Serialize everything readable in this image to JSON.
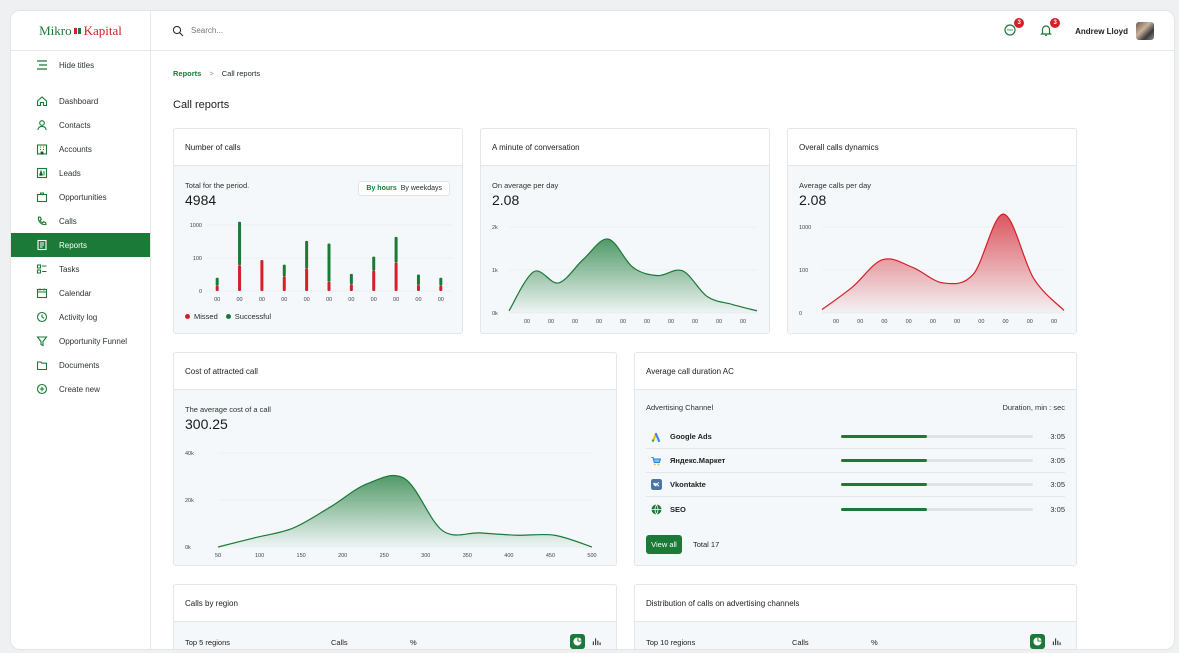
{
  "brand": {
    "left": "Mikro",
    "right": "Kapital"
  },
  "sidebar": {
    "hide_titles": "Hide titles",
    "items": [
      {
        "label": "Dashboard",
        "icon": "home-icon"
      },
      {
        "label": "Contacts",
        "icon": "person-icon"
      },
      {
        "label": "Accounts",
        "icon": "building-icon"
      },
      {
        "label": "Leads",
        "icon": "leads-icon"
      },
      {
        "label": "Opportunities",
        "icon": "briefcase-icon"
      },
      {
        "label": "Calls",
        "icon": "phone-icon"
      },
      {
        "label": "Reports",
        "icon": "report-icon",
        "active": true
      },
      {
        "label": "Tasks",
        "icon": "tasks-icon"
      },
      {
        "label": "Calendar",
        "icon": "calendar-icon"
      },
      {
        "label": "Activity log",
        "icon": "activity-icon"
      },
      {
        "label": "Opportunity Funnel",
        "icon": "funnel-icon"
      },
      {
        "label": "Documents",
        "icon": "folder-icon"
      },
      {
        "label": "Create new",
        "icon": "plus-circle-icon"
      }
    ]
  },
  "header": {
    "search_placeholder": "Search...",
    "chat_badge": "3",
    "bell_badge": "3",
    "user_name": "Andrew Lloyd"
  },
  "breadcrumb": {
    "parent": "Reports",
    "separator": ">",
    "current": "Call reports"
  },
  "page_title": "Call reports",
  "colors": {
    "accent": "#1b7a37",
    "missed": "#d3202b"
  },
  "cards": {
    "number_of_calls": {
      "title": "Number of calls",
      "subtitle": "Total for the period.",
      "value": "4984",
      "toggle": [
        "By hours",
        "By weekdays"
      ],
      "legend": [
        "Missed",
        "Successful"
      ]
    },
    "minute_conversation": {
      "title": "A minute of conversation",
      "subtitle": "On average per day",
      "value": "2.08"
    },
    "overall_dynamics": {
      "title": "Overall calls dynamics",
      "subtitle": "Average calls per day",
      "value": "2.08"
    },
    "cost_attracted": {
      "title": "Cost of attracted call",
      "subtitle": "The average cost of a call",
      "value": "300.25"
    },
    "avg_duration": {
      "title": "Average call duration AC",
      "col_channel": "Advertising Channel",
      "col_duration": "Duration, min : sec",
      "rows": [
        {
          "name": "Google Ads",
          "duration": "3:05",
          "share": 0.45,
          "icon": "google-ads-icon"
        },
        {
          "name": "Яндекс.Маркет",
          "duration": "3:05",
          "share": 0.45,
          "icon": "cart-icon"
        },
        {
          "name": "Vkontakte",
          "duration": "3:05",
          "share": 0.45,
          "icon": "vk-icon"
        },
        {
          "name": "SEO",
          "duration": "3:05",
          "share": 0.45,
          "icon": "globe-icon"
        }
      ],
      "view_all": "View all",
      "total": "Total 17"
    },
    "calls_by_region": {
      "title": "Calls by region",
      "cols": [
        "Top 5 regions",
        "Calls",
        "%"
      ]
    },
    "distribution": {
      "title": "Distribution of calls on advertising channels",
      "cols": [
        "Top 10 regions",
        "Calls",
        "%"
      ]
    }
  },
  "chart_data": [
    {
      "type": "bar",
      "title": "Number of calls",
      "y_ticks": [
        "1000",
        "100",
        "0"
      ],
      "categories": [
        "00",
        "00",
        "00",
        "00",
        "00",
        "00",
        "00",
        "00",
        "00",
        "00",
        "00"
      ],
      "ylim": [
        0,
        1000
      ],
      "series": [
        {
          "name": "Missed",
          "color": "#d3202b",
          "values": [
            80,
            390,
            470,
            220,
            340,
            140,
            100,
            310,
            430,
            90,
            80
          ]
        },
        {
          "name": "Successful",
          "color": "#1b7a37",
          "values": [
            120,
            660,
            0,
            180,
            420,
            580,
            160,
            210,
            390,
            160,
            120
          ]
        }
      ]
    },
    {
      "type": "area",
      "title": "A minute of conversation",
      "y_ticks": [
        "2k",
        "1k",
        "0k"
      ],
      "categories": [
        "00",
        "00",
        "00",
        "00",
        "00",
        "00",
        "00",
        "00",
        "00",
        "00"
      ],
      "ylim": [
        0,
        2000
      ],
      "values": [
        50,
        960,
        700,
        1250,
        1720,
        1060,
        870,
        980,
        380,
        200,
        50
      ],
      "color": "#1b7a37"
    },
    {
      "type": "area",
      "title": "Overall calls dynamics",
      "y_ticks": [
        "1000",
        "100",
        "0"
      ],
      "categories": [
        "00",
        "00",
        "00",
        "00",
        "00",
        "00",
        "00",
        "00",
        "00",
        "00"
      ],
      "ylim": [
        0,
        1000
      ],
      "values": [
        40,
        300,
        620,
        530,
        350,
        450,
        1150,
        400,
        30
      ],
      "color": "#d3202b"
    },
    {
      "type": "area",
      "title": "Cost of attracted call",
      "y_ticks": [
        "40k",
        "20k",
        "0k"
      ],
      "x": [
        "50",
        "100",
        "150",
        "200",
        "250",
        "300",
        "350",
        "400",
        "450",
        "500"
      ],
      "ylim": [
        0,
        40000
      ],
      "values": [
        0,
        4000,
        8000,
        17000,
        27000,
        29000,
        7000,
        6000,
        5000,
        5000,
        0
      ],
      "color": "#1b7a37"
    }
  ]
}
